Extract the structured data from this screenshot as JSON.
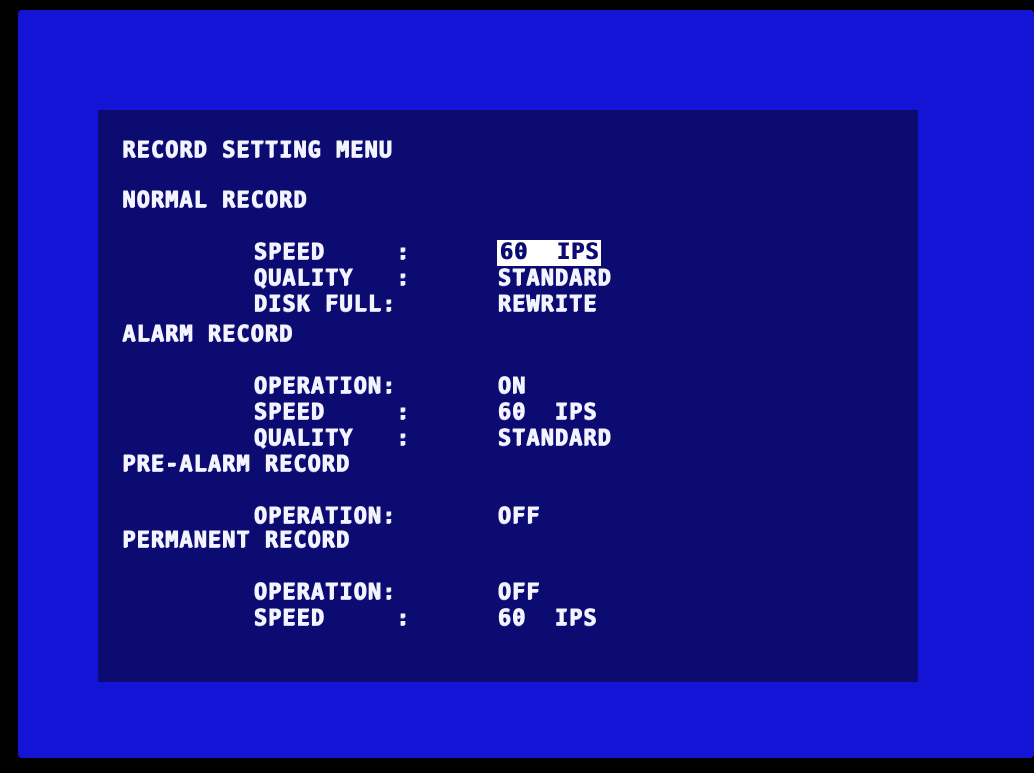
{
  "menu": {
    "title": "RECORD SETTING MENU",
    "sections": [
      {
        "title": "NORMAL RECORD",
        "rows": [
          {
            "label": "SPEED     :",
            "value": "60  IPS"
          },
          {
            "label": "QUALITY   :",
            "value": "STANDARD"
          },
          {
            "label": "DISK FULL:",
            "value": "REWRITE"
          }
        ]
      },
      {
        "title": "ALARM RECORD",
        "rows": [
          {
            "label": "OPERATION:",
            "value": "ON"
          },
          {
            "label": "SPEED     :",
            "value": "60  IPS"
          },
          {
            "label": "QUALITY   :",
            "value": "STANDARD"
          }
        ]
      },
      {
        "title": "PRE-ALARM RECORD",
        "rows": [
          {
            "label": "OPERATION:",
            "value": "OFF"
          }
        ]
      },
      {
        "title": "PERMANENT RECORD",
        "rows": [
          {
            "label": "OPERATION:",
            "value": "OFF"
          },
          {
            "label": "SPEED     :",
            "value": "60  IPS"
          }
        ]
      }
    ]
  },
  "colors": {
    "outer_background": "#1414d6",
    "panel_background": "#0b0b72",
    "text": "#f4f4ff",
    "selection_background": "#ffffff"
  }
}
